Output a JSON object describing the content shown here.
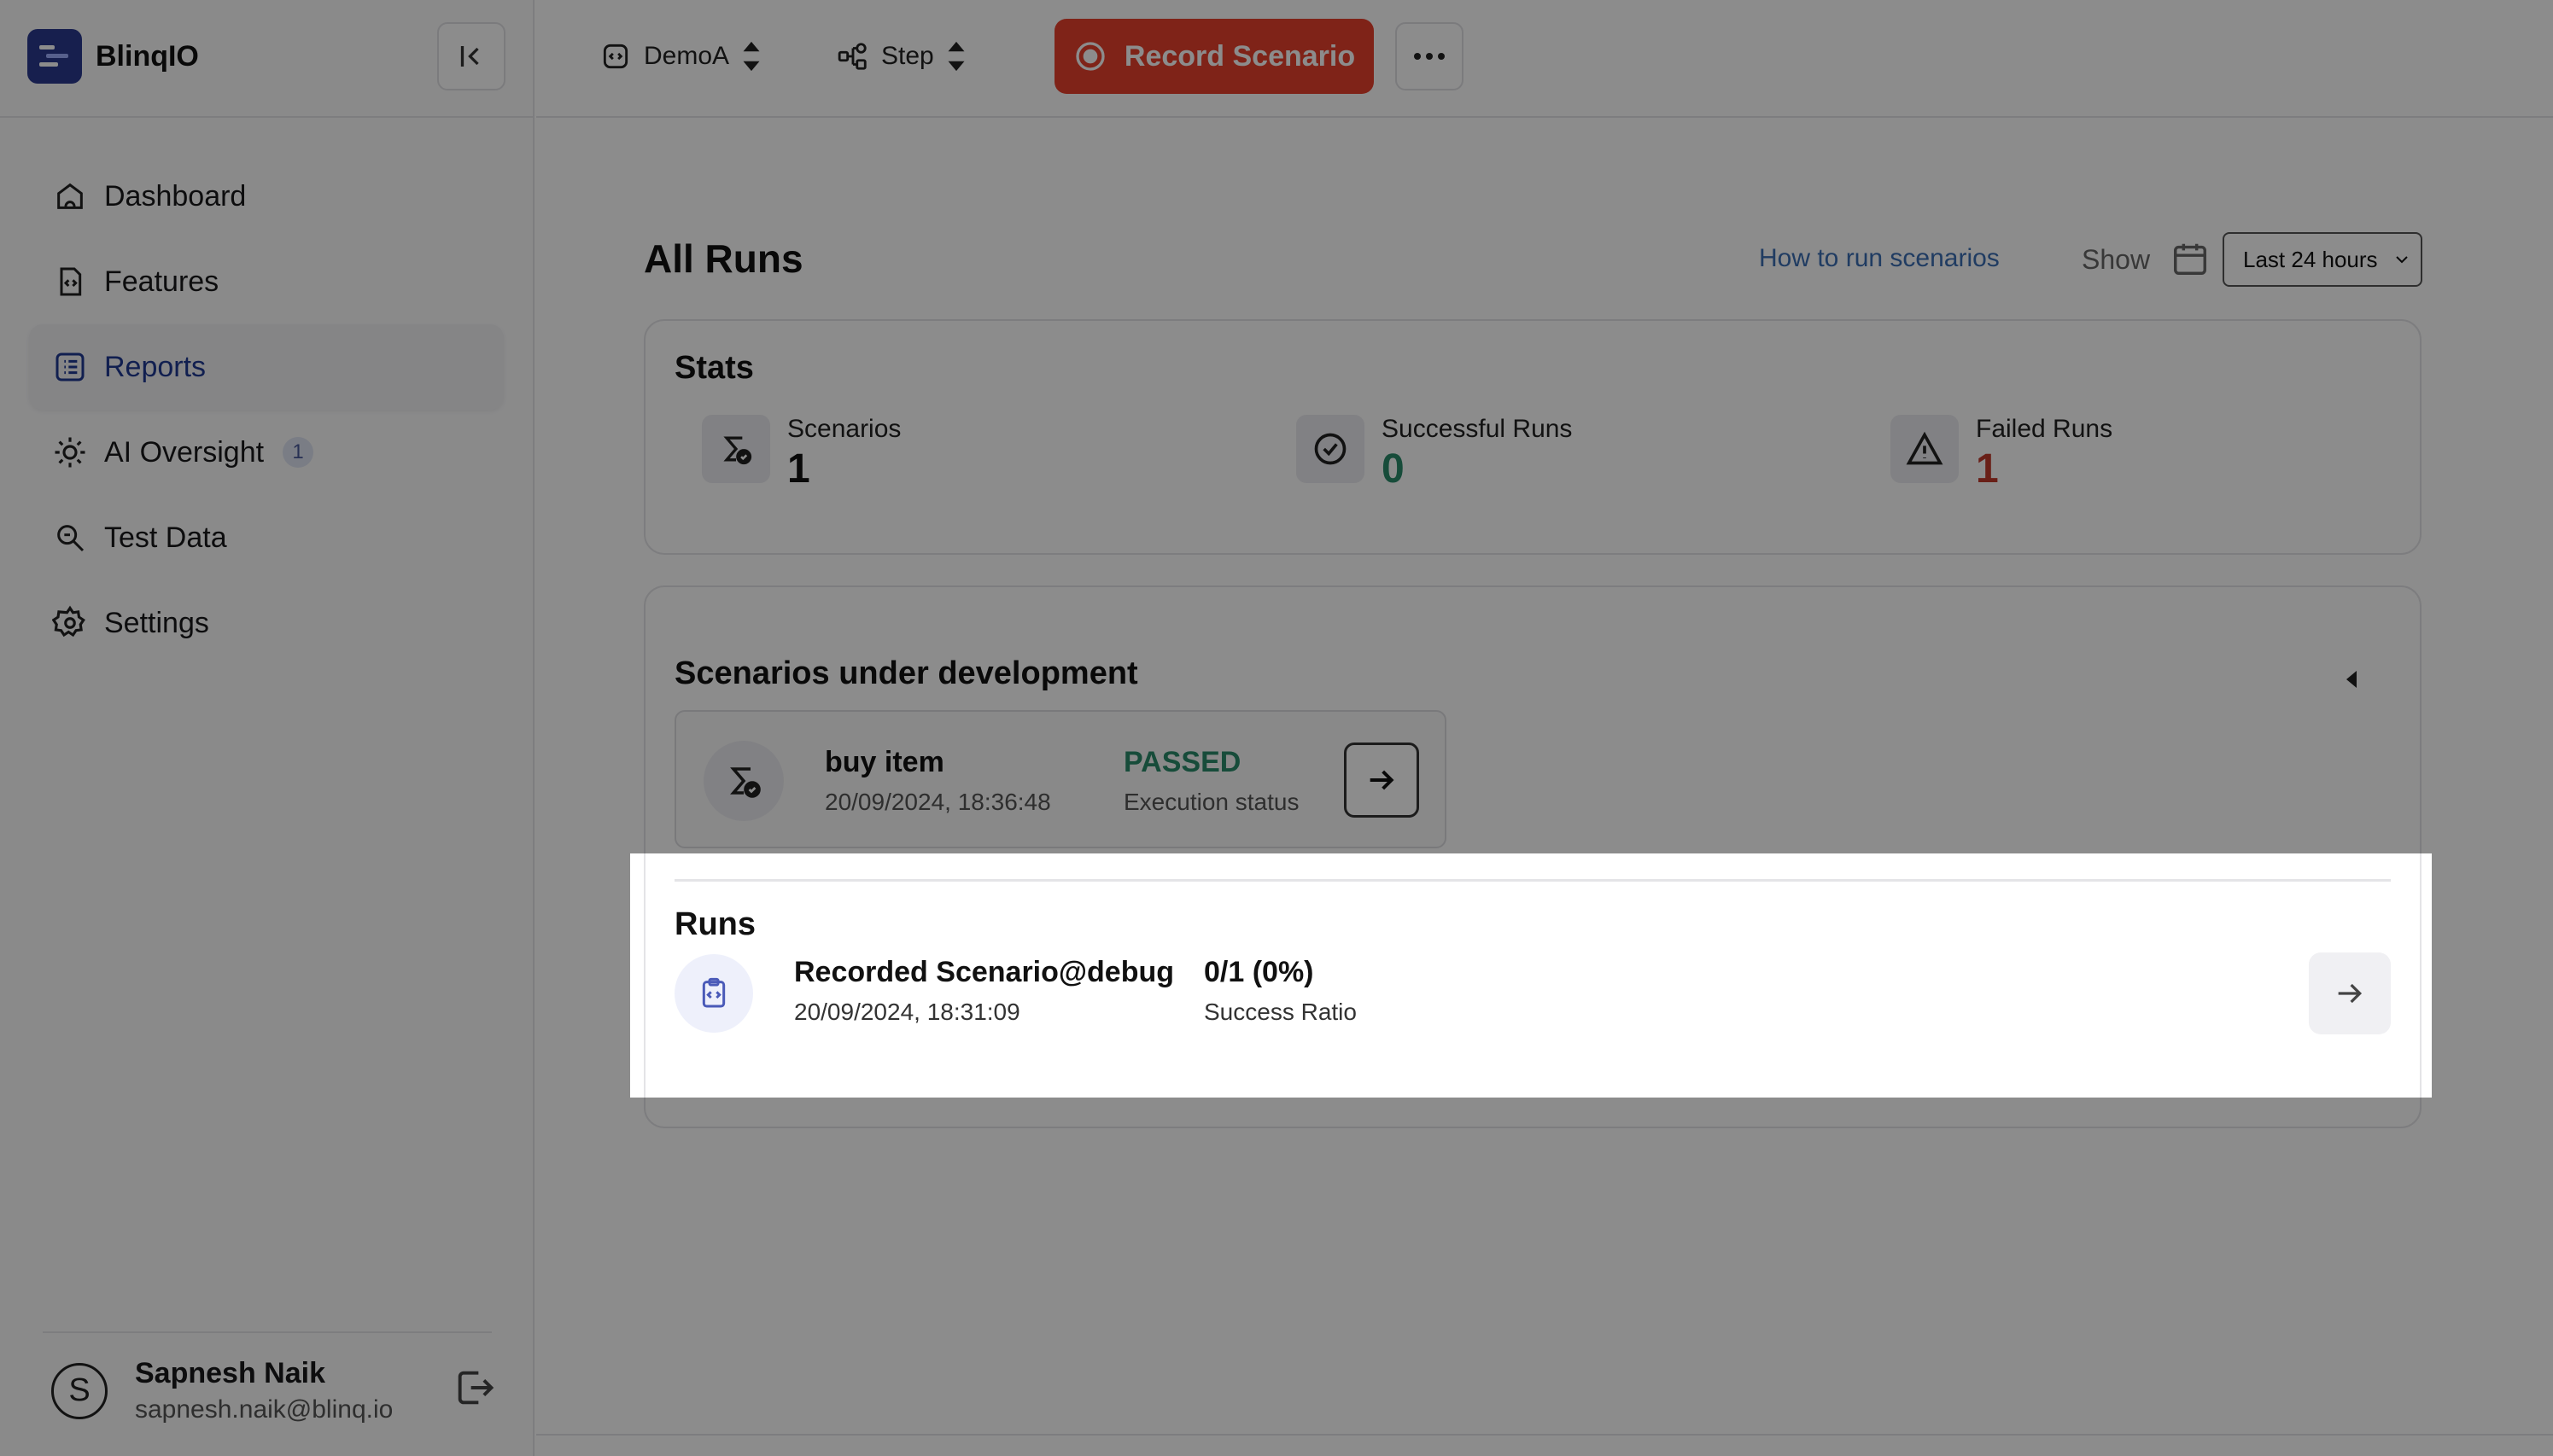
{
  "brand": {
    "name": "BlinqIO"
  },
  "topbar": {
    "project": "DemoA",
    "mode": "Step",
    "record_label": "Record Scenario"
  },
  "sidebar": {
    "items": [
      {
        "label": "Dashboard",
        "icon": "home-icon"
      },
      {
        "label": "Features",
        "icon": "file-code-icon"
      },
      {
        "label": "Reports",
        "icon": "list-icon",
        "active": true
      },
      {
        "label": "AI Oversight",
        "icon": "ai-gear-icon",
        "badge": "1"
      },
      {
        "label": "Test Data",
        "icon": "data-search-icon"
      },
      {
        "label": "Settings",
        "icon": "gear-icon"
      }
    ]
  },
  "user": {
    "initial": "S",
    "name": "Sapnesh Naik",
    "email": "sapnesh.naik@blinq.io"
  },
  "page": {
    "title": "All Runs",
    "howto_link": "How to run scenarios",
    "show_label": "Show",
    "range_value": "Last 24 hours"
  },
  "stats": {
    "title": "Stats",
    "items": [
      {
        "label": "Scenarios",
        "value": "1",
        "color": "#111111"
      },
      {
        "label": "Successful Runs",
        "value": "0",
        "color": "#2a8a6a"
      },
      {
        "label": "Failed Runs",
        "value": "1",
        "color": "#c0392b"
      }
    ]
  },
  "dev": {
    "title": "Scenarios under development",
    "scenario": {
      "name": "buy item",
      "date": "20/09/2024, 18:36:48",
      "status": "PASSED",
      "status_label": "Execution status"
    }
  },
  "runs": {
    "title": "Runs",
    "items": [
      {
        "name": "Recorded Scenario@debug",
        "date": "20/09/2024, 18:31:09",
        "ratio": "0/1 (0%)",
        "ratio_label": "Success Ratio"
      }
    ]
  },
  "colors": {
    "accent": "#1f3a93",
    "record": "#e8402c",
    "passed": "#2a8a6a",
    "failed": "#c0392b"
  }
}
